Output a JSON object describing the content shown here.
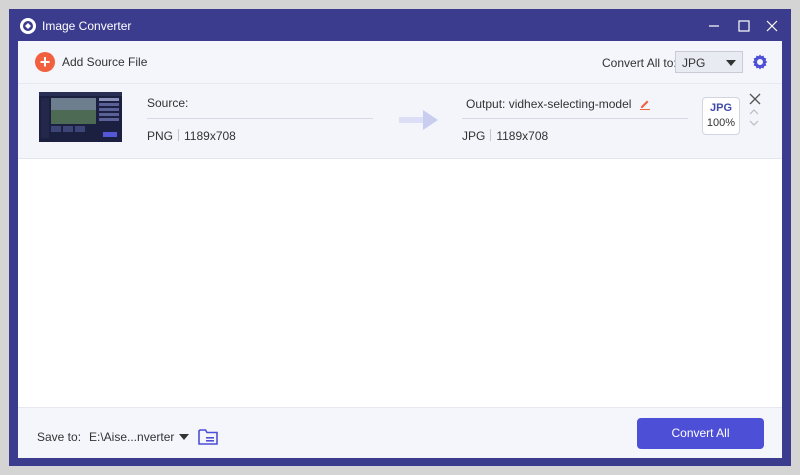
{
  "window": {
    "title": "Image Converter"
  },
  "toolbar": {
    "add_source_label": "Add Source File",
    "convert_all_to_label": "Convert All to:",
    "format_value": "JPG"
  },
  "file": {
    "source_label": "Source:",
    "source_format": "PNG",
    "source_resolution": "1189x708",
    "output_label": "Output: vidhex-selecting-model",
    "output_format": "JPG",
    "output_resolution": "1189x708",
    "badge_format": "JPG",
    "badge_quality": "100%"
  },
  "footer": {
    "save_to_label": "Save to:",
    "save_path": "E:\\Aise...nverter",
    "convert_all_button": "Convert All"
  },
  "colors": {
    "frame": "#3c3c8e",
    "accent": "#4d4fd6",
    "add_button": "#f2613f",
    "edit_icon": "#f2613f"
  }
}
